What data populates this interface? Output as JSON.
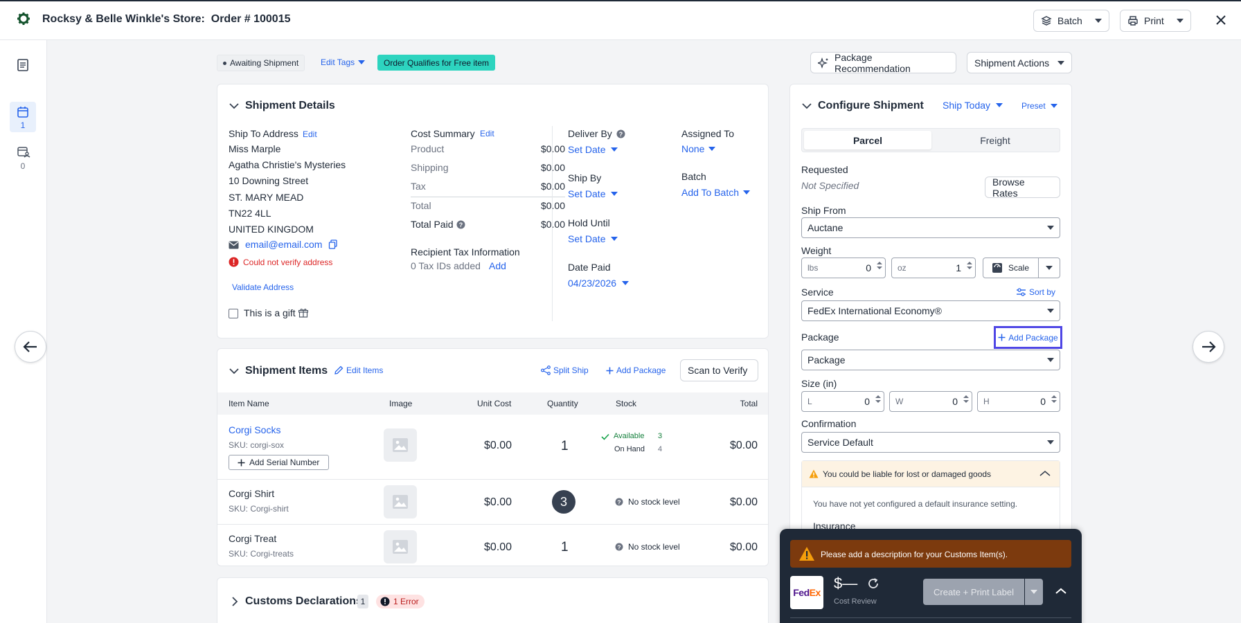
{
  "header": {
    "title": "Rocksy & Belle Winkle's Store:  Order # 100015",
    "batch_label": "Batch",
    "print_label": "Print"
  },
  "sidebar": {
    "items": [
      {
        "icon": "document-icon",
        "count": ""
      },
      {
        "icon": "calendar-icon",
        "count": "1"
      },
      {
        "icon": "user-calendar-icon",
        "count": "0"
      }
    ]
  },
  "order_bar": {
    "status": "Awaiting Shipment",
    "edit_tags": "Edit Tags",
    "tag": "Order Qualifies for Free item",
    "package_recommendation": "Package Recommendation",
    "shipment_actions": "Shipment Actions"
  },
  "shipment_details": {
    "title": "Shipment Details",
    "ship_to_label": "Ship To Address",
    "edit": "Edit",
    "address_lines": [
      "Miss Marple",
      "Agatha Christie's Mysteries",
      "10 Downing Street",
      "ST. MARY MEAD",
      "TN22 4LL",
      "UNITED KINGDOM"
    ],
    "email": "email@email.com",
    "verify_error": "Could not verify address",
    "validate_address": "Validate Address",
    "gift_label": "This is a gift",
    "cost_summary_label": "Cost Summary",
    "cost_edit": "Edit",
    "costs": [
      {
        "label": "Product",
        "value": "$0.00"
      },
      {
        "label": "Shipping",
        "value": "$0.00"
      },
      {
        "label": "Tax",
        "value": "$0.00"
      },
      {
        "label": "Total",
        "value": "$0.00"
      }
    ],
    "total_paid_label": "Total Paid",
    "total_paid_value": "$0.00",
    "recipient_tax_label": "Recipient Tax Information",
    "tax_ids": "0 Tax IDs added",
    "tax_add": "Add",
    "deliver_by_label": "Deliver By",
    "deliver_by_value": "Set Date",
    "ship_by_label": "Ship By",
    "ship_by_value": "Set Date",
    "hold_until_label": "Hold Until",
    "hold_until_value": "Set Date",
    "date_paid_label": "Date Paid",
    "date_paid_value": "04/23/2026",
    "assigned_to_label": "Assigned To",
    "assigned_to_value": "None",
    "batch_label": "Batch",
    "batch_value": "Add To Batch"
  },
  "shipment_items": {
    "title": "Shipment Items",
    "edit_items": "Edit Items",
    "split_ship": "Split Ship",
    "add_package": "Add Package",
    "scan_to_verify": "Scan to Verify",
    "columns": [
      "Item Name",
      "Image",
      "Unit Cost",
      "Quantity",
      "Stock",
      "Total"
    ],
    "rows": [
      {
        "name": "Corgi Socks",
        "sku": "SKU: corgi-sox",
        "unit_cost": "$0.00",
        "quantity": "1",
        "available_label": "Available",
        "available": "3",
        "on_hand_label": "On Hand",
        "on_hand": "4",
        "total": "$0.00",
        "serial": "Add Serial Number"
      },
      {
        "name": "Corgi Shirt",
        "sku": "SKU: Corgi-shirt",
        "unit_cost": "$0.00",
        "quantity": "3",
        "stock": "No stock level",
        "total": "$0.00"
      },
      {
        "name": "Corgi Treat",
        "sku": "SKU: Corgi-treats",
        "unit_cost": "$0.00",
        "quantity": "1",
        "stock": "No stock level",
        "total": "$0.00"
      }
    ]
  },
  "customs": {
    "title": "Customs Declarations",
    "count": "1",
    "error": "1 Error"
  },
  "configure": {
    "title": "Configure Shipment",
    "ship_today": "Ship Today",
    "preset": "Preset",
    "tabs": [
      "Parcel",
      "Freight"
    ],
    "requested_label": "Requested",
    "requested_value": "Not Specified",
    "browse_rates": "Browse Rates",
    "ship_from_label": "Ship From",
    "ship_from_value": "Auctane",
    "weight_label": "Weight",
    "lbs_placeholder": "lbs",
    "lbs_value": "0",
    "oz_placeholder": "oz",
    "oz_value": "1",
    "scale": "Scale",
    "service_label": "Service",
    "sort_by": "Sort by",
    "service_value": "FedEx International Economy®",
    "package_label": "Package",
    "add_package": "Add Package",
    "package_value": "Package",
    "size_label": "Size (in)",
    "size_l": "L",
    "size_l_val": "0",
    "size_w": "W",
    "size_w_val": "0",
    "size_h": "H",
    "size_h_val": "0",
    "confirmation_label": "Confirmation",
    "confirmation_value": "Service Default",
    "insurance_warning": "You could be liable for lost or damaged goods",
    "insurance_note": "You have not yet configured a default insurance setting.",
    "insurance_label": "Insurance"
  },
  "footer": {
    "customs_warning": "Please add a description for your Customs Item(s).",
    "carrier": "FedEx",
    "price": "$—",
    "cost_review": "Cost Review",
    "create_label": "Create + Print Label"
  },
  "colors": {
    "accent": "#2563eb",
    "tag": "#2dd4bf",
    "error": "#dc2626",
    "dark_panel": "#1f2937",
    "warning_bar": "#7c3a0e"
  }
}
